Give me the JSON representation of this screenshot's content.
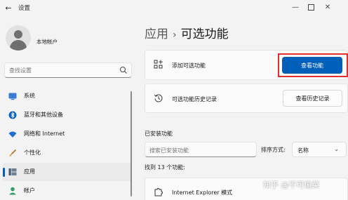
{
  "window": {
    "back_icon": "back-arrow-icon",
    "title": "设置",
    "controls": [
      "minimize-icon",
      "maximize-icon",
      "close-icon"
    ]
  },
  "account": {
    "name": "本地帐户"
  },
  "sidebar": {
    "search_placeholder": "查找设置",
    "items": [
      {
        "label": "系统",
        "icon": "system-icon",
        "active": false
      },
      {
        "label": "蓝牙和其他设备",
        "icon": "bluetooth-icon",
        "active": false
      },
      {
        "label": "网络和 Internet",
        "icon": "wifi-icon",
        "active": false
      },
      {
        "label": "个性化",
        "icon": "brush-icon",
        "active": false
      },
      {
        "label": "应用",
        "icon": "apps-icon",
        "active": true
      },
      {
        "label": "帐户",
        "icon": "account-icon",
        "active": false
      }
    ]
  },
  "breadcrumb": {
    "parent": "应用",
    "separator": "›",
    "current": "可选功能"
  },
  "add_feature": {
    "label": "添加可选功能",
    "icon": "add-grid-icon",
    "button": "查看功能"
  },
  "history": {
    "label": "可选功能历史记录",
    "icon": "history-icon",
    "button": "查看历史记录"
  },
  "installed": {
    "title": "已安装功能",
    "search_placeholder": "搜索已安装功能",
    "sort_label": "排序方式:",
    "sort_value": "名称",
    "count_text": "找到 13 个功能:",
    "features": [
      {
        "label": "Internet Explorer 模式",
        "icon": "puzzle-icon"
      }
    ]
  },
  "watermark": "知乎 @不可偷菜",
  "colors": {
    "accent": "#005fb8",
    "highlight_frame": "#e03030",
    "background": "#f3f3f3"
  }
}
